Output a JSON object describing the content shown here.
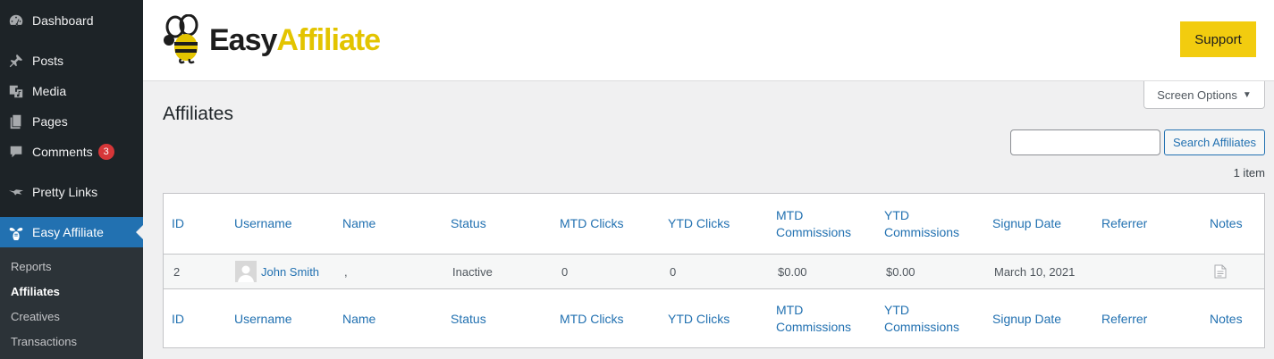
{
  "sidebar": {
    "items": [
      {
        "label": "Dashboard",
        "icon": "dashboard-icon"
      },
      {
        "label": "Posts",
        "icon": "pin-icon"
      },
      {
        "label": "Media",
        "icon": "media-icon"
      },
      {
        "label": "Pages",
        "icon": "pages-icon"
      },
      {
        "label": "Comments",
        "icon": "comment-icon",
        "badge": "3"
      },
      {
        "label": "Pretty Links",
        "icon": "pretty-links-icon"
      },
      {
        "label": "Easy Affiliate",
        "icon": "bee-icon",
        "active": true
      }
    ],
    "submenu": [
      {
        "label": "Reports"
      },
      {
        "label": "Affiliates",
        "current": true
      },
      {
        "label": "Creatives"
      },
      {
        "label": "Transactions"
      }
    ]
  },
  "header": {
    "logo_easy": "Easy",
    "logo_affiliate": "Affiliate",
    "support_label": "Support"
  },
  "screen_options": {
    "label": "Screen Options",
    "caret": "▼"
  },
  "page_title": "Affiliates",
  "search": {
    "value": "",
    "button_label": "Search Affiliates"
  },
  "item_count": "1 item",
  "table": {
    "columns": [
      {
        "l1": "ID",
        "l2": ""
      },
      {
        "l1": "Username",
        "l2": ""
      },
      {
        "l1": "Name",
        "l2": ""
      },
      {
        "l1": "Status",
        "l2": ""
      },
      {
        "l1": "MTD Clicks",
        "l2": ""
      },
      {
        "l1": "YTD Clicks",
        "l2": ""
      },
      {
        "l1": "MTD",
        "l2": "Commissions"
      },
      {
        "l1": "YTD",
        "l2": "Commissions"
      },
      {
        "l1": "Signup Date",
        "l2": ""
      },
      {
        "l1": "Referrer",
        "l2": ""
      },
      {
        "l1": "Notes",
        "l2": ""
      }
    ],
    "rows": [
      {
        "id": "2",
        "username": "John Smith",
        "name": ",",
        "status": "Inactive",
        "mtd_clicks": "0",
        "ytd_clicks": "0",
        "mtd_commissions": "$0.00",
        "ytd_commissions": "$0.00",
        "signup_date": "March 10, 2021",
        "referrer": ""
      }
    ]
  },
  "colors": {
    "accent": "#2271b1",
    "sidebar": "#1d2327",
    "support": "#f2cc0f",
    "logo_yellow": "#e3c400"
  }
}
